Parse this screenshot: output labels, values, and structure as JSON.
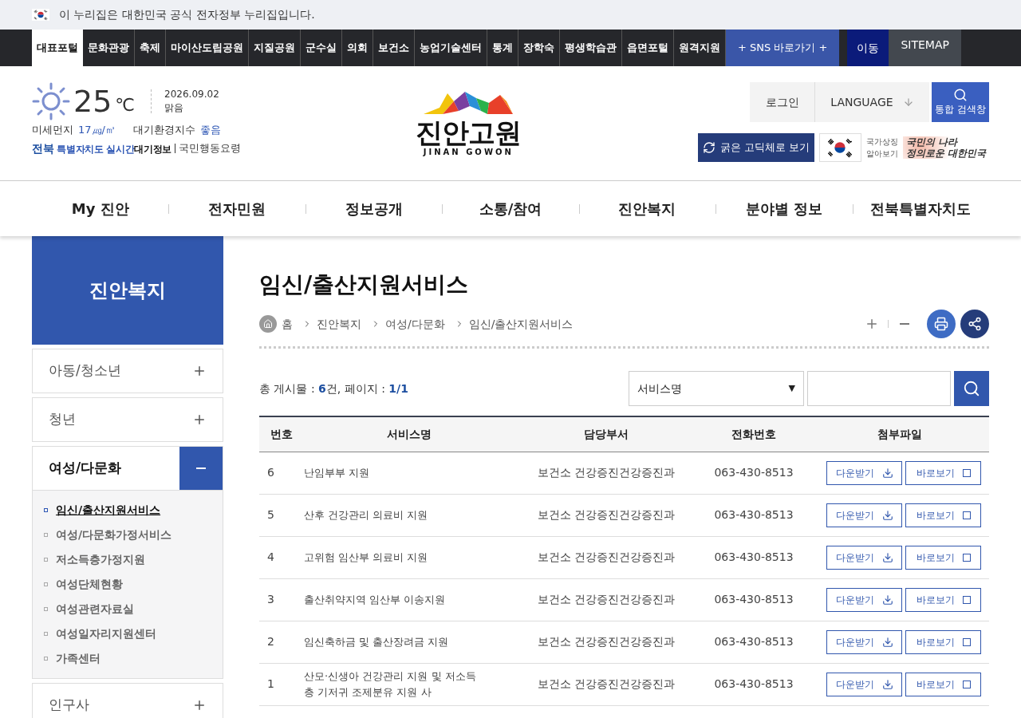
{
  "gov_banner": {
    "text": "이 누리집은 대한민국 공식 전자정부 누리집입니다."
  },
  "top_nav": {
    "tabs": [
      {
        "label": "대표포털",
        "selected": true
      },
      {
        "label": "문화관광",
        "selected": false
      },
      {
        "label": "축제",
        "selected": false
      },
      {
        "label": "마이산도립공원",
        "selected": false
      },
      {
        "label": "지질공원",
        "selected": false
      },
      {
        "label": "군수실",
        "selected": false
      },
      {
        "label": "의회",
        "selected": false
      },
      {
        "label": "보건소",
        "selected": false
      },
      {
        "label": "농업기술센터",
        "selected": false
      },
      {
        "label": "통계",
        "selected": false
      },
      {
        "label": "장학숙",
        "selected": false
      },
      {
        "label": "평생학습관",
        "selected": false
      },
      {
        "label": "읍면포털",
        "selected": false
      },
      {
        "label": "원격지원",
        "selected": false
      }
    ],
    "sns_button": "+ SNS 바로가기 +",
    "move_button": "이동",
    "sitemap": "SITEMAP"
  },
  "weather": {
    "temperature": "25",
    "unit": "℃",
    "date": "2026.09.02",
    "condition": "맑음",
    "dust_label": "미세먼지",
    "dust_value": "17㎍/㎥",
    "aqi_label": "대기환경지수",
    "aqi_value": "좋음",
    "air_link": [
      "전북",
      "특별자치도 실시간",
      "대기정보"
    ],
    "action_link": "국민행동요령"
  },
  "logo": {
    "title": "진안고원",
    "subtitle": "JINAN GOWON"
  },
  "utility": {
    "login": "로그인",
    "language": "LANGUAGE",
    "search": "통합 검색창",
    "font_toggle": "굵은 고딕체로 보기",
    "symbol_link": [
      "국가상징",
      "알아보기"
    ],
    "slogan": [
      "국민의 나라",
      "정의로운 대한민국"
    ]
  },
  "main_nav": [
    "My 진안",
    "전자민원",
    "정보공개",
    "소통/참여",
    "진안복지",
    "분야별 정보",
    "전북특별자치도"
  ],
  "sidebar": {
    "title": "진안복지",
    "items": [
      {
        "label": "아동/청소년",
        "expanded": false
      },
      {
        "label": "청년",
        "expanded": false
      },
      {
        "label": "여성/다문화",
        "expanded": true,
        "children": [
          {
            "label": "임신/출산지원서비스",
            "selected": true
          },
          {
            "label": "여성/다문화가정서비스",
            "selected": false
          },
          {
            "label": "저소득층가정지원",
            "selected": false
          },
          {
            "label": "여성단체현황",
            "selected": false
          },
          {
            "label": "여성관련자료실",
            "selected": false
          },
          {
            "label": "여성일자리지원센터",
            "selected": false
          },
          {
            "label": "가족센터",
            "selected": false
          }
        ]
      },
      {
        "label": "인구사",
        "expanded": false
      }
    ]
  },
  "content": {
    "title": "임신/출산지원서비스",
    "breadcrumb": [
      "홈",
      "진안복지",
      "여성/다문화",
      "임신/출산지원서비스"
    ],
    "summary": {
      "total_label": "총 게시물 :",
      "total": "6",
      "total_unit": "건, 페이지 :",
      "page": "1/1"
    },
    "search": {
      "select": "서비스명",
      "caret": "▼"
    },
    "table": {
      "columns": [
        "번호",
        "서비스명",
        "담당부서",
        "전화번호",
        "첨부파일"
      ],
      "rows": [
        {
          "number": "6",
          "service": "난임부부 지원",
          "department": "보건소 건강증진건강증진과",
          "phone": "063-430-8513",
          "download": "다운받기",
          "view": "바로보기"
        },
        {
          "number": "5",
          "service": "산후 건강관리 의료비 지원",
          "department": "보건소 건강증진건강증진과",
          "phone": "063-430-8513",
          "download": "다운받기",
          "view": "바로보기"
        },
        {
          "number": "4",
          "service": "고위험 임산부 의료비 지원",
          "department": "보건소 건강증진건강증진과",
          "phone": "063-430-8513",
          "download": "다운받기",
          "view": "바로보기"
        },
        {
          "number": "3",
          "service": "출산취약지역 임산부 이송지원",
          "department": "보건소 건강증진건강증진과",
          "phone": "063-430-8513",
          "download": "다운받기",
          "view": "바로보기"
        },
        {
          "number": "2",
          "service": "임신축하금 및 출산장려금 지원",
          "department": "보건소 건강증진건강증진과",
          "phone": "063-430-8513",
          "download": "다운받기",
          "view": "바로보기"
        },
        {
          "number": "1",
          "service": "산모·신생아 건강관리 지원 및 저소득층 기저귀 조제분유 지원 사",
          "department": "보건소 건강증진건강증진과",
          "phone": "063-430-8513",
          "download": "다운받기",
          "view": "바로보기"
        }
      ]
    }
  }
}
